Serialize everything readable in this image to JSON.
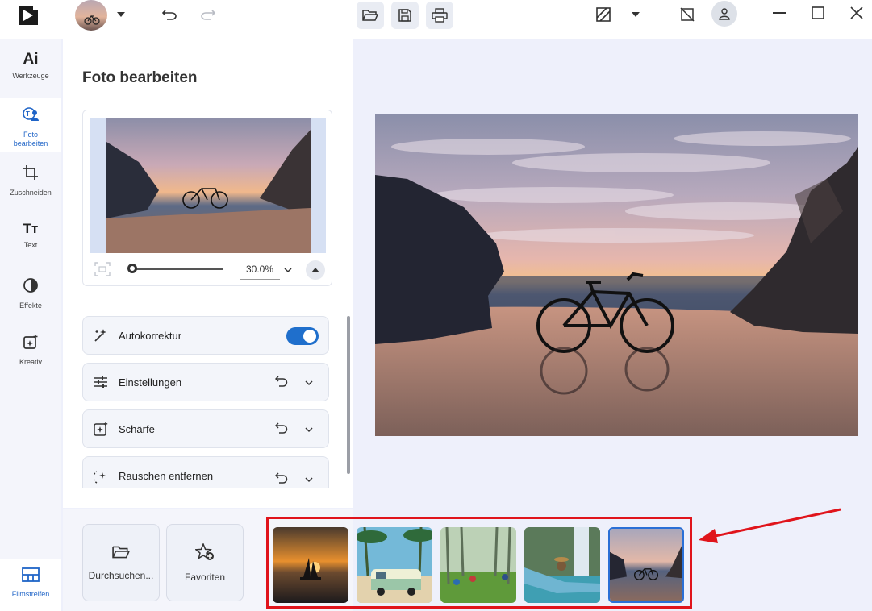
{
  "titlebar": {
    "icons": [
      "app-logo-icon",
      "avatar",
      "chevron-down-icon",
      "undo-icon",
      "redo-icon",
      "open-folder-icon",
      "save-icon",
      "print-icon",
      "compare-icon",
      "chevron-down-icon",
      "hide-panel-icon",
      "account-icon",
      "minimize-icon",
      "maximize-icon",
      "close-icon"
    ]
  },
  "rail": {
    "items": [
      {
        "icon": "ai-icon",
        "label": "Werkzeuge",
        "glyph": "Ai"
      },
      {
        "icon": "photo-edit-icon",
        "label": "Foto bearbeiten"
      },
      {
        "icon": "crop-icon",
        "label": "Zuschneiden"
      },
      {
        "icon": "text-icon",
        "label": "Text",
        "glyph": "Tт"
      },
      {
        "icon": "effects-icon",
        "label": "Effekte"
      },
      {
        "icon": "creative-icon",
        "label": "Kreativ"
      }
    ],
    "filmstrip": {
      "icon": "filmstrip-icon",
      "label": "Filmstreifen"
    }
  },
  "panel": {
    "title": "Foto bearbeiten",
    "zoom": {
      "value": "30.0%",
      "level": 0.0
    },
    "sections": [
      {
        "label": "Autokorrektur",
        "icon": "magic-wand-icon",
        "toggle": true
      },
      {
        "label": "Einstellungen",
        "icon": "sliders-icon"
      },
      {
        "label": "Schärfe",
        "icon": "sharpen-icon"
      },
      {
        "label": "Rauschen entfernen",
        "icon": "denoise-icon"
      }
    ]
  },
  "bottom": {
    "browse": "Durchsuchen...",
    "favorites": "Favoriten"
  },
  "filmstrip": {
    "thumbs": [
      "sailboat-sunset",
      "camper-van-beach",
      "children-meadow",
      "woman-waterfall",
      "bicycle-beach"
    ],
    "selected_index": 4
  },
  "colors": {
    "accent": "#1f64c7",
    "highlight": "#e0141b",
    "toggle": "#1f6fcc"
  }
}
